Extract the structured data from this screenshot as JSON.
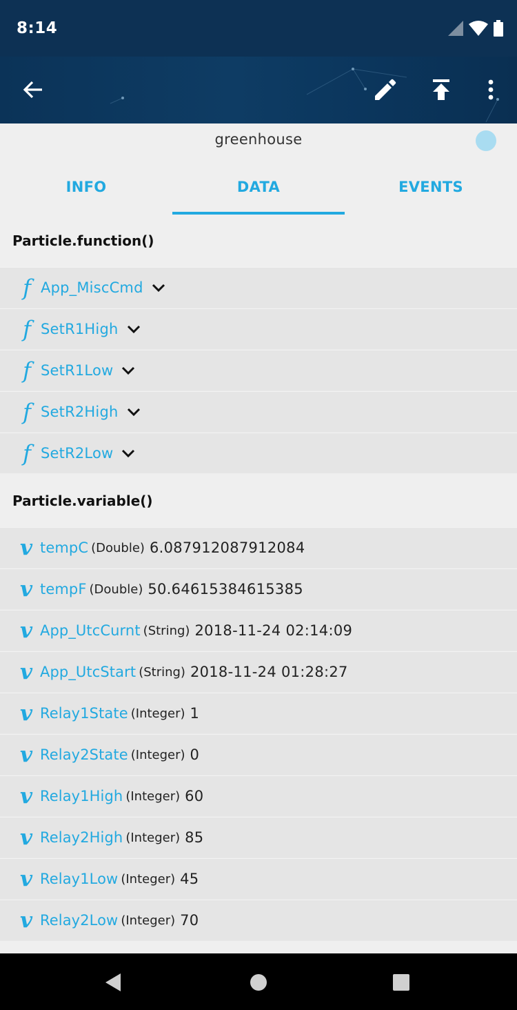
{
  "status_bar": {
    "time": "8:14",
    "icons": [
      "signal-icon",
      "wifi-icon",
      "battery-icon"
    ]
  },
  "app_bar": {
    "actions": [
      "back-arrow-icon",
      "edit-pencil-icon",
      "flash-upload-icon",
      "more-vert-icon"
    ]
  },
  "device": {
    "name": "greenhouse",
    "status_color": "#a9dcf1"
  },
  "tabs": [
    {
      "label": "INFO",
      "active": false
    },
    {
      "label": "DATA",
      "active": true
    },
    {
      "label": "EVENTS",
      "active": false
    }
  ],
  "functions": {
    "header": "Particle.function()",
    "glyph": "f",
    "items": [
      {
        "name": "App_MiscCmd"
      },
      {
        "name": "SetR1High"
      },
      {
        "name": "SetR1Low"
      },
      {
        "name": "SetR2High"
      },
      {
        "name": "SetR2Low"
      }
    ]
  },
  "variables": {
    "header": "Particle.variable()",
    "glyph": "v",
    "items": [
      {
        "name": "tempC",
        "type": "(Double)",
        "value": "6.087912087912084"
      },
      {
        "name": "tempF",
        "type": "(Double)",
        "value": "50.64615384615385"
      },
      {
        "name": "App_UtcCurnt",
        "type": "(String)",
        "value": "2018-11-24 02:14:09"
      },
      {
        "name": "App_UtcStart",
        "type": "(String)",
        "value": "2018-11-24 01:28:27"
      },
      {
        "name": "Relay1State",
        "type": "(Integer)",
        "value": "1"
      },
      {
        "name": "Relay2State",
        "type": "(Integer)",
        "value": "0"
      },
      {
        "name": "Relay1High",
        "type": "(Integer)",
        "value": "60"
      },
      {
        "name": "Relay2High",
        "type": "(Integer)",
        "value": "85"
      },
      {
        "name": "Relay1Low",
        "type": "(Integer)",
        "value": "45"
      },
      {
        "name": "Relay2Low",
        "type": "(Integer)",
        "value": "70"
      }
    ]
  },
  "nav_bar": {
    "buttons": [
      "back-triangle-icon",
      "home-circle-icon",
      "recents-square-icon"
    ]
  },
  "colors": {
    "accent": "#22a9e0",
    "app_bar": "#0d3154",
    "row_bg": "#e5e5e5"
  }
}
